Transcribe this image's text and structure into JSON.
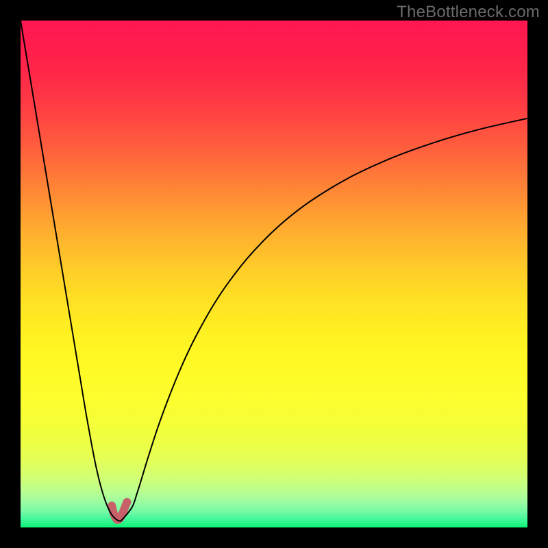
{
  "watermark": "TheBottleneck.com",
  "gradient": {
    "stops": [
      {
        "offset": 0.0,
        "color": "#ff1750"
      },
      {
        "offset": 0.05,
        "color": "#ff1d4d"
      },
      {
        "offset": 0.1,
        "color": "#ff2749"
      },
      {
        "offset": 0.15,
        "color": "#ff3645"
      },
      {
        "offset": 0.2,
        "color": "#ff4941"
      },
      {
        "offset": 0.25,
        "color": "#ff5e3d"
      },
      {
        "offset": 0.3,
        "color": "#ff7639"
      },
      {
        "offset": 0.35,
        "color": "#ff8e34"
      },
      {
        "offset": 0.4,
        "color": "#ffa630"
      },
      {
        "offset": 0.45,
        "color": "#ffbc2c"
      },
      {
        "offset": 0.5,
        "color": "#ffd028"
      },
      {
        "offset": 0.55,
        "color": "#ffe024"
      },
      {
        "offset": 0.6,
        "color": "#ffed22"
      },
      {
        "offset": 0.65,
        "color": "#fff623"
      },
      {
        "offset": 0.7,
        "color": "#fffb28"
      },
      {
        "offset": 0.75,
        "color": "#fcfe2f"
      },
      {
        "offset": 0.8,
        "color": "#f4ff3a"
      },
      {
        "offset": 0.83,
        "color": "#eeff44"
      },
      {
        "offset": 0.86,
        "color": "#e6ff52"
      },
      {
        "offset": 0.88,
        "color": "#ddff62"
      },
      {
        "offset": 0.9,
        "color": "#d2ff73"
      },
      {
        "offset": 0.915,
        "color": "#c7fe82"
      },
      {
        "offset": 0.93,
        "color": "#b8fe90"
      },
      {
        "offset": 0.94,
        "color": "#abfd99"
      },
      {
        "offset": 0.95,
        "color": "#9bfca0"
      },
      {
        "offset": 0.96,
        "color": "#87fba4"
      },
      {
        "offset": 0.97,
        "color": "#6ffaa4"
      },
      {
        "offset": 0.978,
        "color": "#56f8a0"
      },
      {
        "offset": 0.985,
        "color": "#3ef797"
      },
      {
        "offset": 0.992,
        "color": "#28f58a"
      },
      {
        "offset": 1.0,
        "color": "#0bf475"
      }
    ]
  },
  "chart_data": {
    "type": "line",
    "title": "",
    "xlabel": "",
    "ylabel": "",
    "xlim": [
      0,
      100
    ],
    "ylim": [
      0,
      100
    ],
    "series": [
      {
        "name": "bottleneck-curve",
        "x": [
          0.0,
          1.0,
          2.0,
          3.0,
          4.0,
          5.0,
          6.0,
          7.0,
          8.0,
          9.0,
          10.0,
          11.0,
          12.0,
          13.0,
          14.0,
          15.0,
          16.0,
          17.0,
          18.0,
          19.0,
          19.5,
          20.0,
          22.0,
          23.0,
          24.0,
          25.0,
          27.0,
          29.0,
          31.0,
          33.0,
          35.0,
          38.0,
          41.0,
          45.0,
          50.0,
          55.0,
          60.0,
          65.0,
          70.0,
          75.0,
          80.0,
          85.0,
          90.0,
          95.0,
          100.0
        ],
        "y": [
          100.0,
          94.0,
          88.0,
          82.0,
          76.0,
          70.0,
          64.0,
          58.0,
          52.0,
          46.0,
          40.0,
          34.0,
          28.0,
          22.0,
          16.5,
          11.5,
          7.5,
          4.5,
          2.5,
          1.5,
          1.3,
          1.5,
          4.0,
          6.8,
          10.0,
          13.3,
          19.5,
          25.0,
          30.0,
          34.5,
          38.5,
          43.8,
          48.3,
          53.4,
          58.6,
          62.8,
          66.2,
          69.1,
          71.5,
          73.6,
          75.4,
          77.0,
          78.4,
          79.6,
          80.7
        ]
      },
      {
        "name": "bottom-marker",
        "x": [
          18.0,
          18.3,
          18.6,
          18.9,
          19.1,
          19.4,
          19.7,
          20.0,
          20.3,
          20.6,
          21.0
        ],
        "y": [
          4.3,
          3.0,
          2.2,
          1.7,
          1.5,
          1.6,
          1.9,
          2.5,
          3.2,
          4.0,
          5.0
        ]
      }
    ],
    "colors": {
      "bottleneck-curve": "#000000",
      "bottom-marker": "#c8606a"
    }
  }
}
